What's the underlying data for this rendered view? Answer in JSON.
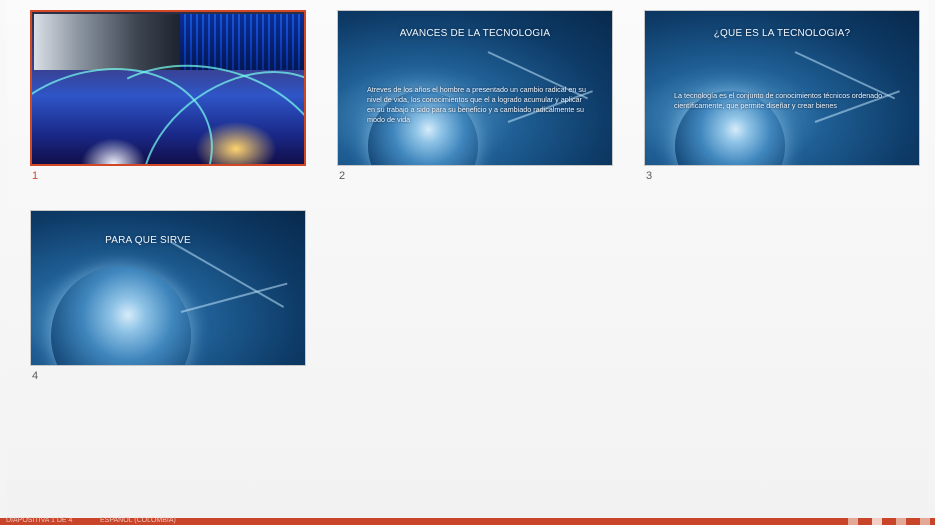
{
  "sorter": {
    "slides": [
      {
        "number": "1",
        "title": "",
        "body": "",
        "selected": true
      },
      {
        "number": "2",
        "title": "AVANCES DE LA TECNOLOGIA",
        "body": "Atreves de los años el hombre a presentado un cambio radical en su nivel de vida, los conocimientos que el a logrado acumular y aplicar en su trabajo a sido para su beneficio y a cambiado radicalmente su modo de vida"
      },
      {
        "number": "3",
        "title": "¿QUE ES LA TECNOLOGIA?",
        "body": "La tecnología es el conjunto de conocimientos técnicos ordenado científicamente, que permite diseñar y crear bienes"
      },
      {
        "number": "4",
        "title": "PARA QUE SIRVE",
        "body": ""
      }
    ]
  },
  "statusbar": {
    "color": "#c9452a",
    "slide_info": "DIAPOSITIVA 1 DE 4",
    "language": "ESPAÑOL (COLOMBIA)",
    "views": [
      "normal-view-icon",
      "slide-sorter-view-icon",
      "reading-view-icon",
      "slideshow-icon"
    ]
  },
  "accent": "#d24726"
}
